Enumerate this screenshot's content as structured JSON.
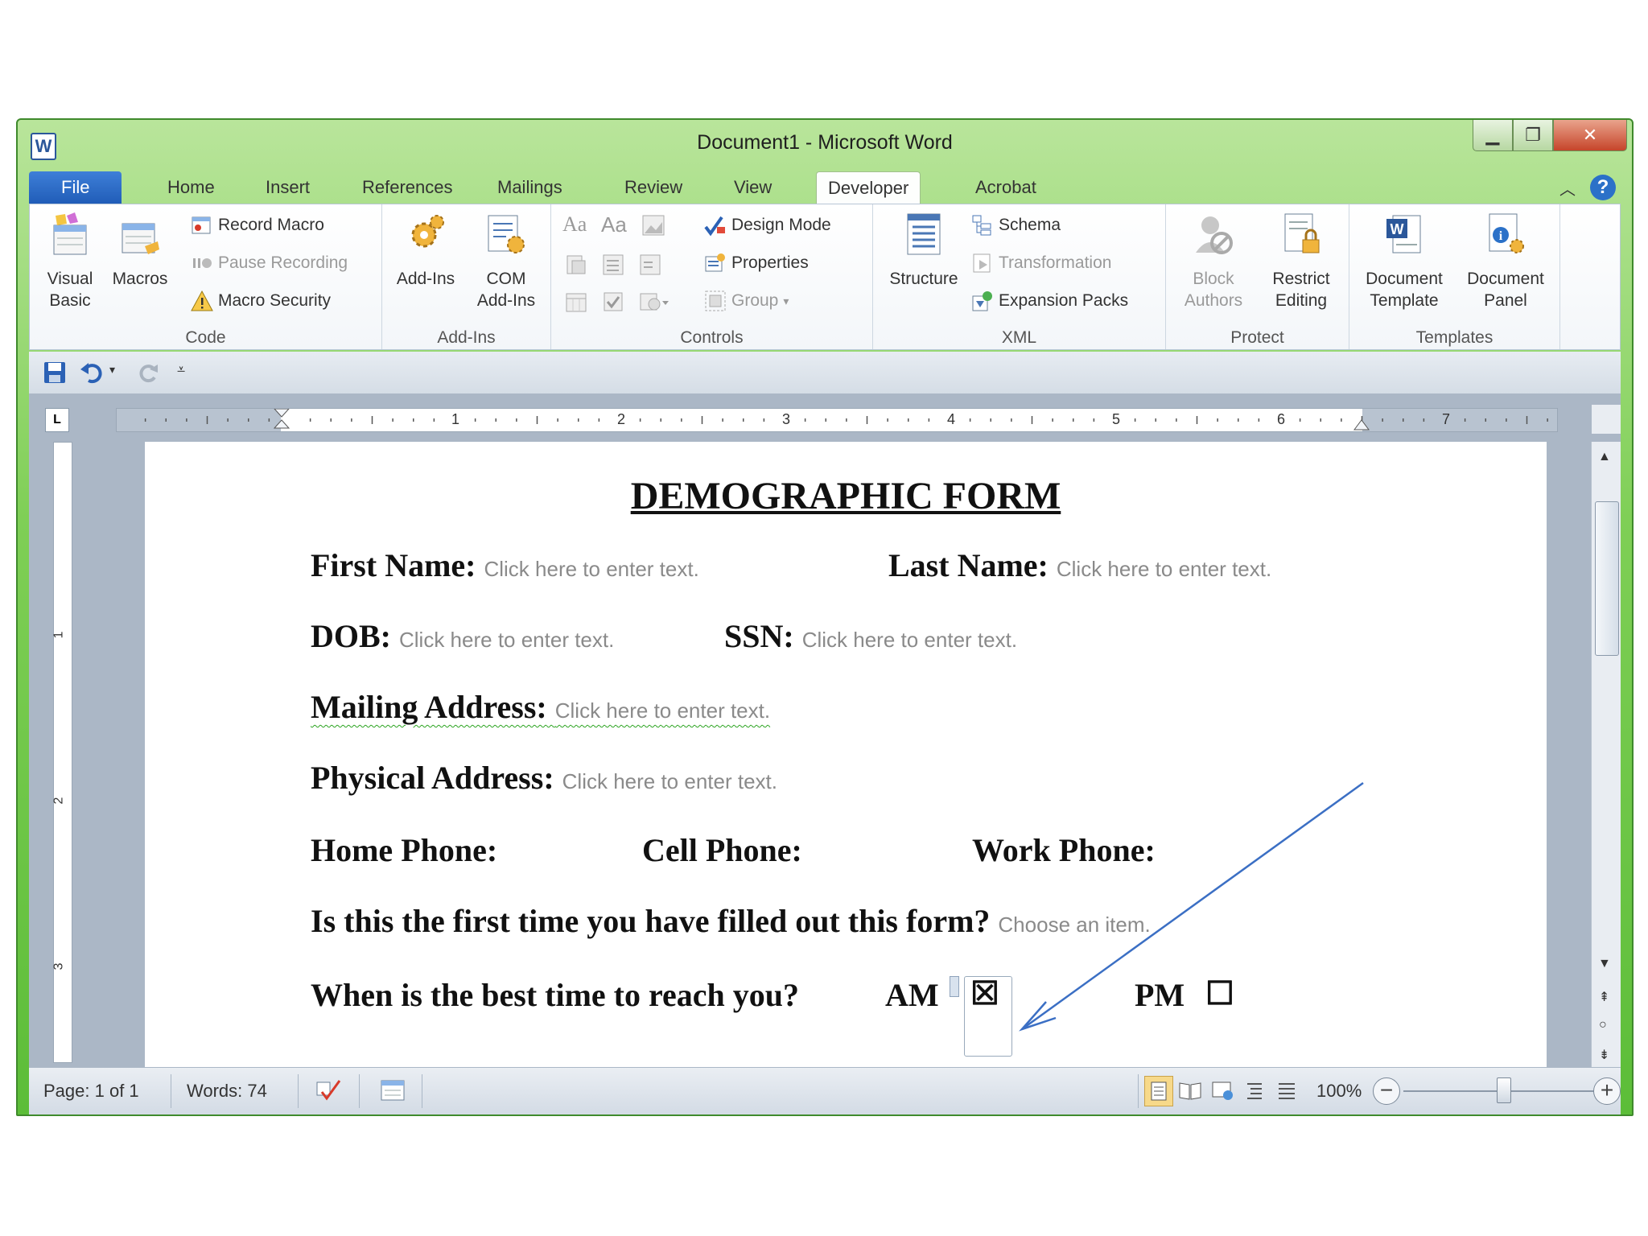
{
  "window": {
    "title": "Document1  -  Microsoft Word",
    "app_icon": "W"
  },
  "tabs": [
    "File",
    "Home",
    "Insert",
    "References",
    "Mailings",
    "Review",
    "View",
    "Developer",
    "Acrobat"
  ],
  "active_tab": "Developer",
  "ribbon": {
    "code": {
      "label": "Code",
      "visual_basic": [
        "Visual",
        "Basic"
      ],
      "macros": "Macros",
      "record_macro": "Record Macro",
      "pause_recording": "Pause Recording",
      "macro_security": "Macro Security"
    },
    "addins": {
      "label": "Add-Ins",
      "addins": "Add-Ins",
      "com_addins": [
        "COM",
        "Add-Ins"
      ]
    },
    "controls": {
      "label": "Controls",
      "design_mode": "Design Mode",
      "properties": "Properties",
      "group": "Group",
      "rich_text": "Aa",
      "plain_text": "Aa"
    },
    "xml": {
      "label": "XML",
      "structure": "Structure",
      "schema": "Schema",
      "transformation": "Transformation",
      "expansion_packs": "Expansion Packs"
    },
    "protect": {
      "label": "Protect",
      "block_authors": [
        "Block",
        "Authors"
      ],
      "restrict_editing": [
        "Restrict",
        "Editing"
      ]
    },
    "templates": {
      "label": "Templates",
      "document_template": [
        "Document",
        "Template"
      ],
      "document_panel": [
        "Document",
        "Panel"
      ]
    }
  },
  "ruler": {
    "numbers": [
      "1",
      "2",
      "3",
      "4",
      "5",
      "6",
      "7"
    ],
    "vertical_numbers": [
      "1",
      "2",
      "3"
    ],
    "corner": "L"
  },
  "document": {
    "title": "DEMOGRAPHIC FORM",
    "placeholder": "Click here to enter text.",
    "first_name_label": "First Name:",
    "last_name_label": "Last Name:",
    "dob_label": "DOB:",
    "ssn_label": "SSN:",
    "mailing_label": "Mailing Address:",
    "physical_label": "Physical Address:",
    "home_phone_label": "Home Phone:",
    "cell_phone_label": "Cell Phone:",
    "work_phone_label": "Work Phone:",
    "first_time_label": "Is this the first time you have filled out this form?",
    "first_time_placeholder": "Choose an item.",
    "best_time_label": "When is the best time to reach you?",
    "am_label": "AM",
    "am_checkbox": "☒",
    "pm_label": "PM",
    "pm_checkbox": "☐"
  },
  "status": {
    "page": "Page: 1 of 1",
    "words": "Words: 74",
    "zoom": "100%"
  },
  "colors": {
    "title_bar": "#7fcf56",
    "file_tab": "#1f5bb6",
    "placeholder_text": "#8a8a8a",
    "annotation_arrow": "#3b6fc4"
  }
}
